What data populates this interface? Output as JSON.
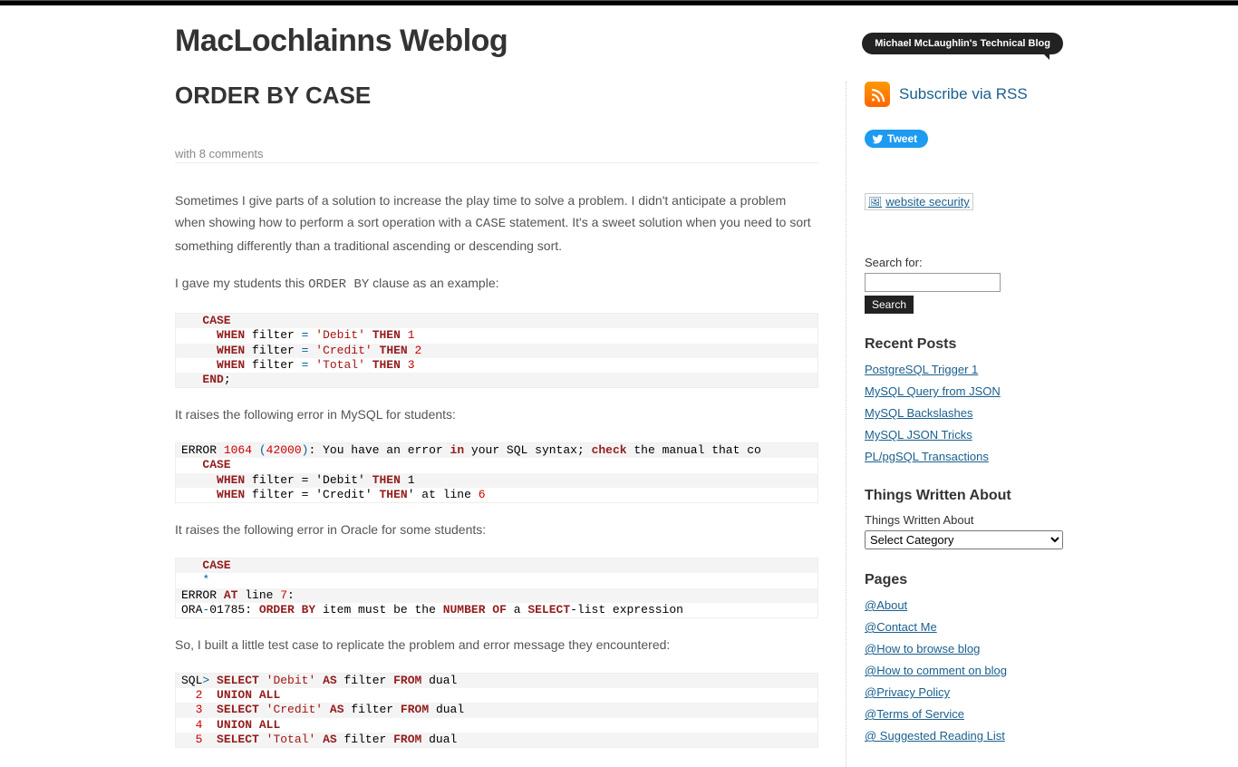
{
  "site": {
    "title": "MacLochlainns Weblog",
    "tagline": "Michael McLaughlin's Technical Blog"
  },
  "post": {
    "title": "ORDER BY CASE",
    "comments_text": "with 8 comments",
    "para1_a": "Sometimes I give parts of a solution to increase the play time to solve a problem. I didn't anticipate a problem when showing how to perform a sort operation with a ",
    "para1_code": "CASE",
    "para1_b": " statement. It's a sweet solution when you need to sort something differently than a traditional ascending or descending sort.",
    "para2_a": "I gave my students this ",
    "para2_code": "ORDER BY",
    "para2_b": " clause as an example:",
    "para3": "It raises the following error in MySQL for students:",
    "para4": "It raises the following error in Oracle for some students:",
    "para5": "So, I built a little test case to replicate the problem and error message they encountered:"
  },
  "sidebar": {
    "rss_label": "Subscribe via RSS",
    "tweet_label": "Tweet",
    "security_alt": "website security",
    "search_label": "Search for:",
    "search_button": "Search",
    "recent_title": "Recent Posts",
    "recent": [
      "PostgreSQL Trigger 1",
      "MySQL Query from JSON",
      "MySQL Backslashes",
      "MySQL JSON Tricks",
      "PL/pgSQL Transactions"
    ],
    "things_title": "Things Written About",
    "things_label": "Things Written About",
    "things_selected": "Select Category",
    "pages_title": "Pages",
    "pages": [
      "@About",
      "@Contact Me",
      "@How to browse blog",
      "@How to comment on blog",
      "@Privacy Policy",
      "@Terms of Service",
      "@ Suggested Reading List"
    ]
  }
}
